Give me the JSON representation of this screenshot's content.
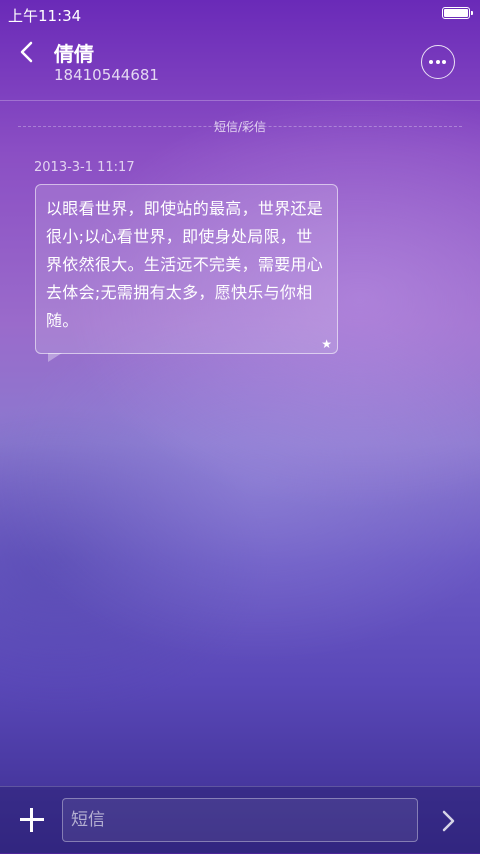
{
  "status_bar": {
    "time": "上午11:34",
    "battery_icon": "battery-full-icon"
  },
  "header": {
    "back_icon": "chevron-left-icon",
    "contact_name": "倩倩",
    "contact_number": "18410544681",
    "more_icon": "more-horizontal-icon"
  },
  "thread": {
    "channel_label": "短信/彩信",
    "message": {
      "timestamp": "2013-3-1 11:17",
      "text": "以眼看世界，即使站的最高，世界还是很小;以心看世界，即使身处局限，世界依然很大。生活远不完美，需要用心去体会;无需拥有太多，愿快乐与你相随。",
      "star_icon": "star-icon"
    }
  },
  "composer": {
    "add_icon": "plus-icon",
    "placeholder": "短信",
    "send_icon": "chevron-right-icon"
  }
}
